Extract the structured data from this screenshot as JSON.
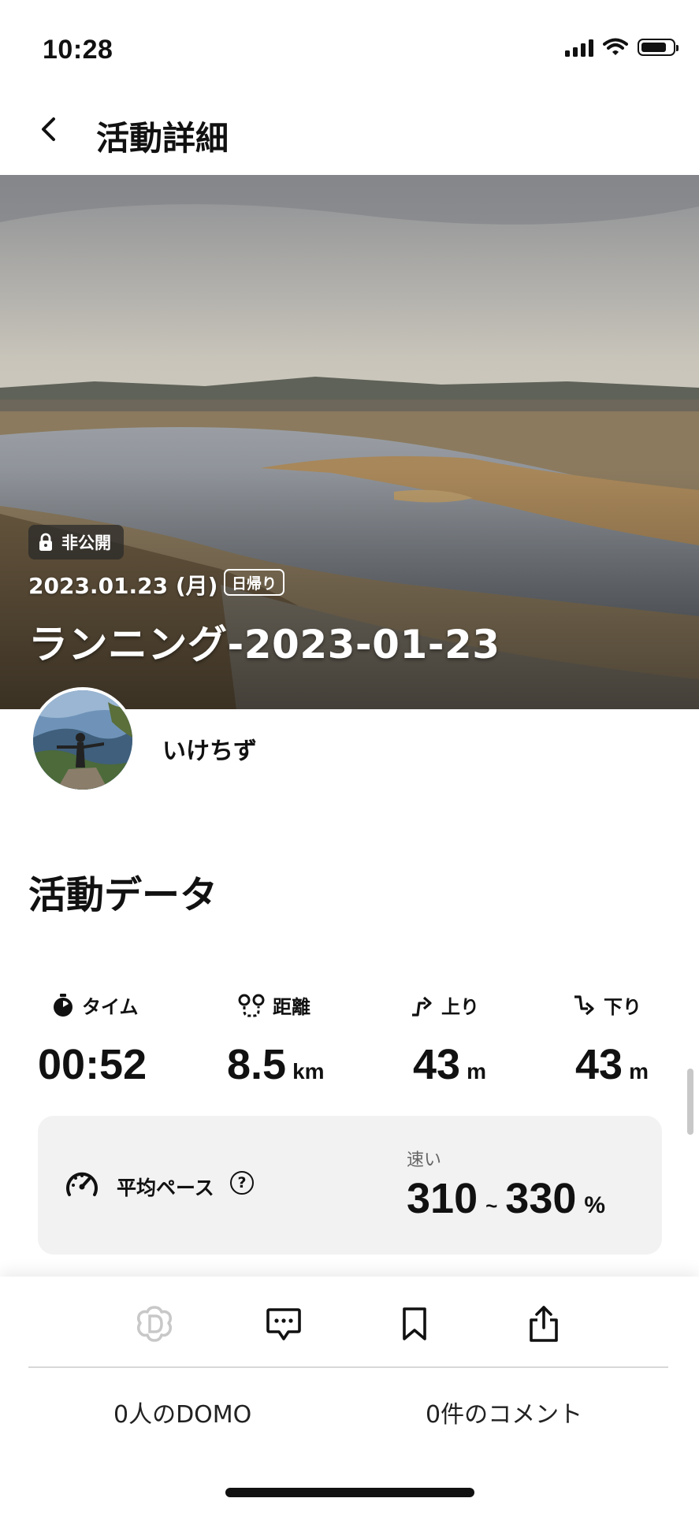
{
  "status_bar": {
    "time": "10:28",
    "battery_level": 0.85,
    "icons": [
      "signal-icon",
      "wifi-icon",
      "battery-icon"
    ]
  },
  "header": {
    "title": "活動詳細",
    "back_icon": "chevron-left-icon"
  },
  "hero": {
    "privacy_badge": "非公開",
    "date": "2023.01.23 (月)",
    "trip_type_badge": "日帰り",
    "activity_title": "ランニング-2023-01-23"
  },
  "user": {
    "name": "いけちず"
  },
  "activity_data": {
    "section_title": "活動データ",
    "stats": [
      {
        "label": "タイム",
        "value": "00:52",
        "unit": "",
        "icon": "stopwatch-icon"
      },
      {
        "label": "距離",
        "value": "8.5",
        "unit": "km",
        "icon": "route-icon"
      },
      {
        "label": "上り",
        "value": "43",
        "unit": "m",
        "icon": "ascent-icon"
      },
      {
        "label": "下り",
        "value": "43",
        "unit": "m",
        "icon": "descent-icon"
      }
    ],
    "pace": {
      "label": "平均ペース",
      "help": "?",
      "speed_label": "速い",
      "range_low": "310",
      "range_sep": "~",
      "range_high": "330",
      "unit": "%"
    }
  },
  "actions": {
    "icons": [
      "domo-icon",
      "comment-icon",
      "bookmark-icon",
      "share-icon"
    ],
    "domo_count": "0人のDOMO",
    "comment_count": "0件のコメント"
  },
  "colors": {
    "text": "#111111",
    "card_bg": "#f2f2f2",
    "muted": "#666666",
    "domo_inactive": "#c8c8c8"
  }
}
